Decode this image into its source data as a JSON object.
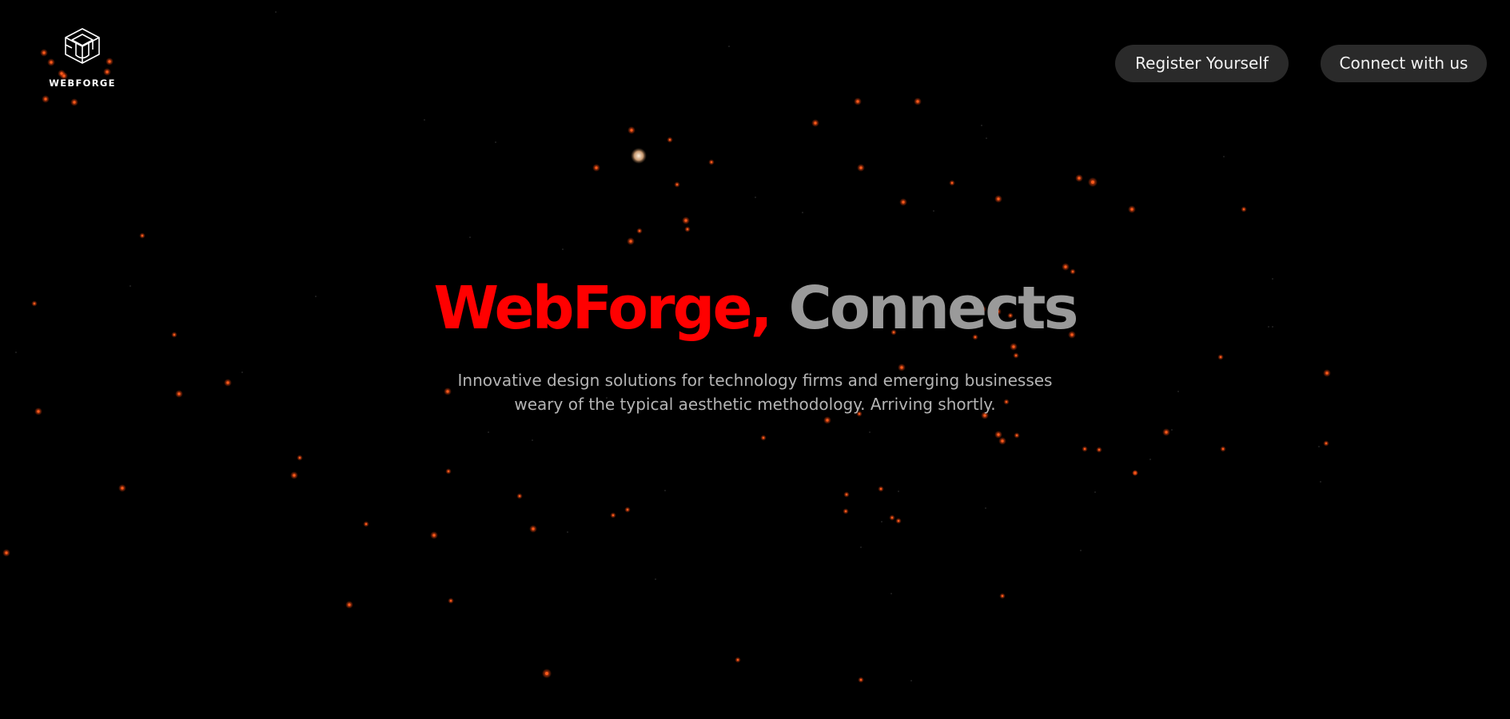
{
  "header": {
    "logo_text": "WEBFORGE",
    "logo_icon": "cube-mortarboard-icon"
  },
  "nav": {
    "register_label": "Register Yourself",
    "connect_label": "Connect with us",
    "button_bg": "#2a2a2a"
  },
  "hero": {
    "title_brand": "WebForge,",
    "title_rest": "Connects",
    "brand_color": "#ff0000",
    "rest_color": "#9a9a9a",
    "subtitle_line1": "Innovative design solutions for technology firms and emerging businesses",
    "subtitle_line2": "weary of the typical aesthetic methodology. Arriving shortly."
  },
  "background": {
    "color": "#000000",
    "particle_color": "#ff5a1a"
  }
}
